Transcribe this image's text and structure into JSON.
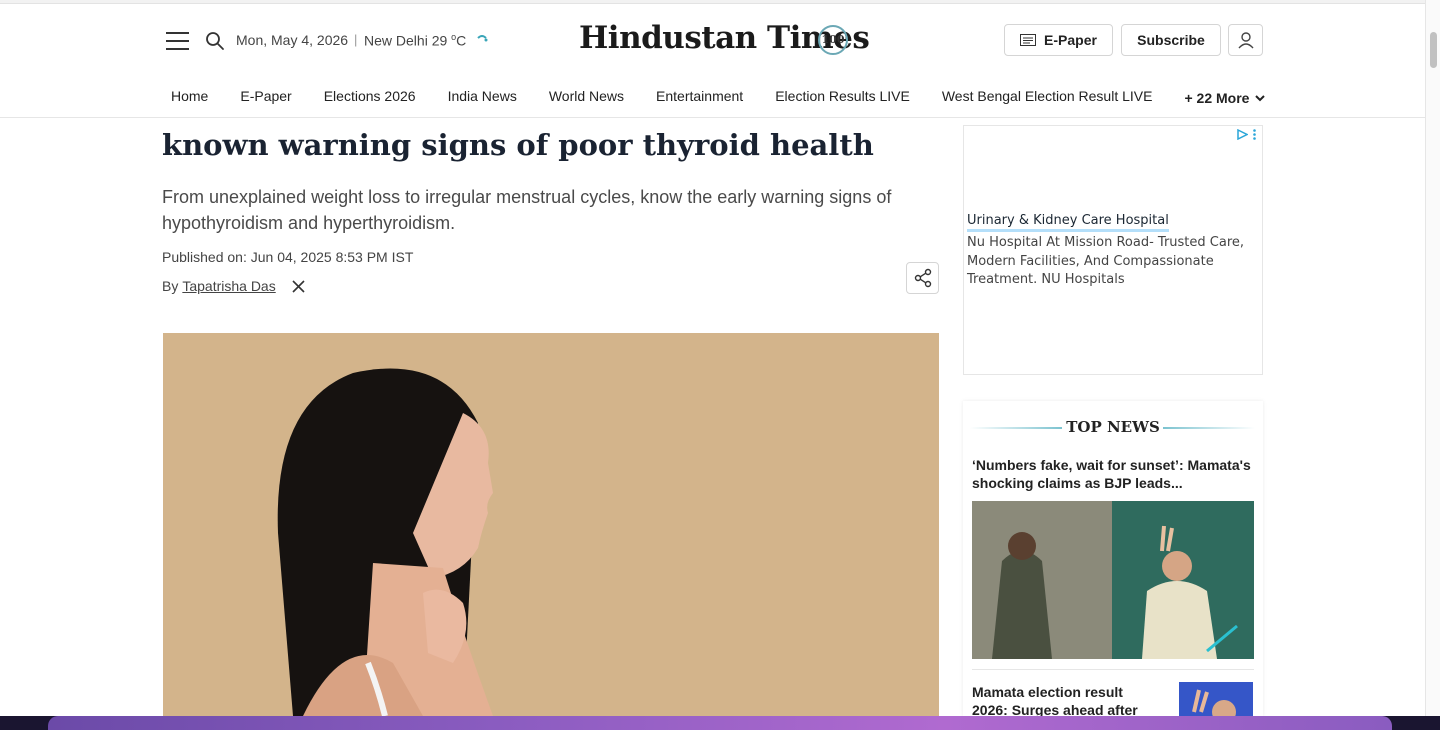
{
  "header": {
    "date": "Mon, May 4, 2026",
    "separator": "|",
    "city": "New Delhi 29",
    "temp_unit": "°C",
    "logo": "Hindustan Times",
    "logo_badge": "100",
    "epaper_label": "E-Paper",
    "subscribe_label": "Subscribe"
  },
  "nav": {
    "items": [
      {
        "label": "Home"
      },
      {
        "label": "E-Paper"
      },
      {
        "label": "Elections 2026"
      },
      {
        "label": "India News"
      },
      {
        "label": "World News"
      },
      {
        "label": "Entertainment"
      },
      {
        "label": "Election Results LIVE"
      },
      {
        "label": "West Bengal Election Result LIVE"
      }
    ],
    "more_label": "+ 22 More"
  },
  "article": {
    "headline": "known warning signs of poor thyroid health",
    "summary": "From unexplained weight loss to irregular menstrual cycles, know the early warning signs of hypothyroidism and hyperthyroidism.",
    "published": "Published on: Jun 04, 2025 8:53 PM IST",
    "by": "By",
    "author": "Tapatrisha Das"
  },
  "ad": {
    "title": "Urinary & Kidney Care Hospital",
    "body": "Nu Hospital At Mission Road- Trusted Care, Modern Facilities, And Compassionate Treatment. NU Hospitals"
  },
  "topnews": {
    "title": "TOP NEWS",
    "stories": [
      {
        "headline": "‘Numbers fake, wait for sunset’: Mamata's shocking claims as BJP leads..."
      },
      {
        "headline": "Mamata election result 2026: Surges ahead after"
      }
    ]
  },
  "colors": {
    "headline": "#1a2332",
    "accent": "#7cc3d0",
    "ad_highlight": "#b4dffa"
  }
}
